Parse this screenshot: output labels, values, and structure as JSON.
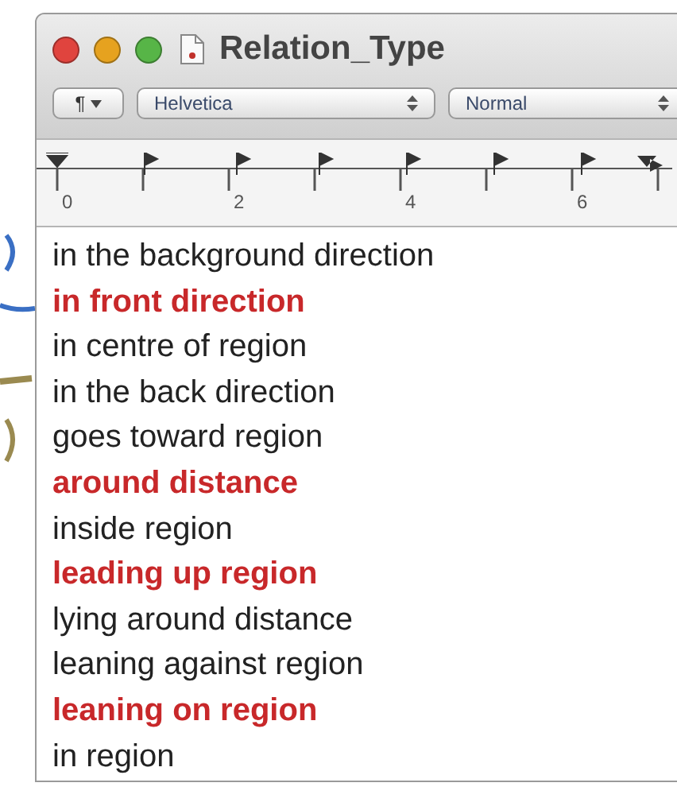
{
  "window": {
    "title": "Relation_Type"
  },
  "toolbar": {
    "paragraph_button": "¶",
    "font_select": "Helvetica",
    "style_select": "Normal"
  },
  "ruler": {
    "labels": [
      "0",
      "2",
      "4",
      "6"
    ]
  },
  "lines": [
    {
      "text": "in the background direction",
      "highlighted": false
    },
    {
      "text": "in front direction",
      "highlighted": true
    },
    {
      "text": "in centre of region",
      "highlighted": false
    },
    {
      "text": "in the back direction",
      "highlighted": false
    },
    {
      "text": "goes toward region",
      "highlighted": false
    },
    {
      "text": "around distance",
      "highlighted": true
    },
    {
      "text": "inside region",
      "highlighted": false
    },
    {
      "text": "leading up region",
      "highlighted": true
    },
    {
      "text": "lying around distance",
      "highlighted": false
    },
    {
      "text": "leaning against region",
      "highlighted": false
    },
    {
      "text": "leaning on region",
      "highlighted": true
    },
    {
      "text": "in region",
      "highlighted": false
    }
  ]
}
